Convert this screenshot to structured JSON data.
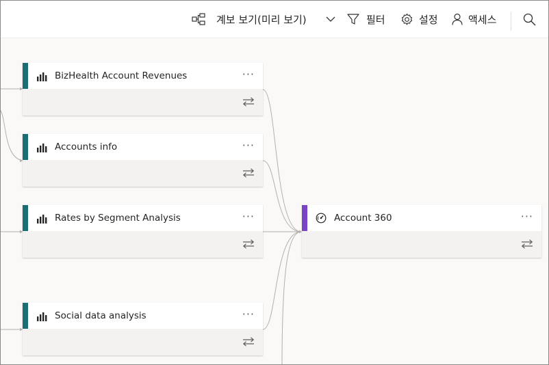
{
  "toolbar": {
    "view_label": "계보 보기(미리 보기)",
    "filter_label": "필터",
    "settings_label": "설정",
    "access_label": "액세스",
    "icons": [
      "lineage-view-icon",
      "chevron-down-icon",
      "filter-icon",
      "gear-icon",
      "person-icon",
      "search-icon"
    ]
  },
  "cards": [
    {
      "title": "BizHealth Account Revenues",
      "type": "report",
      "accent": "#1b6e73",
      "more": "···"
    },
    {
      "title": "Accounts info",
      "type": "report",
      "accent": "#1b6e73",
      "more": "···"
    },
    {
      "title": "Rates by Segment Analysis",
      "type": "report",
      "accent": "#1b6e73",
      "more": "···"
    },
    {
      "title": "Social data analysis",
      "type": "report",
      "accent": "#1b6e73",
      "more": "···"
    }
  ],
  "target_card": {
    "title": "Account 360",
    "type": "dashboard",
    "accent": "#7b44c4",
    "more": "···"
  },
  "colors": {
    "line": "#b3b0ad",
    "card_body": "#f3f2f1",
    "background": "#faf9f8"
  }
}
